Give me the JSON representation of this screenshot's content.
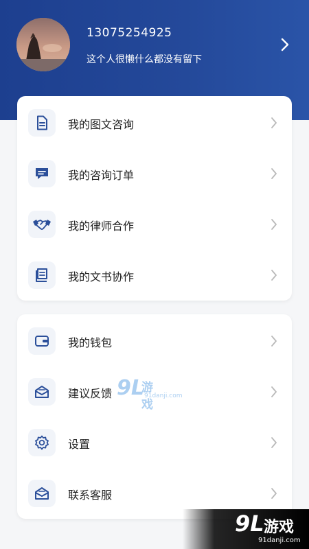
{
  "profile": {
    "phone": "13075254925",
    "signature": "这个人很懒什么都没有留下"
  },
  "menu_group_1": [
    {
      "label": "我的图文咨询",
      "icon": "document-icon"
    },
    {
      "label": "我的咨询订单",
      "icon": "chat-icon"
    },
    {
      "label": "我的律师合作",
      "icon": "handshake-icon"
    },
    {
      "label": "我的文书协作",
      "icon": "book-icon"
    }
  ],
  "menu_group_2": [
    {
      "label": "我的钱包",
      "icon": "wallet-icon"
    },
    {
      "label": "建议反馈",
      "icon": "feedback-icon"
    },
    {
      "label": "设置",
      "icon": "gear-icon"
    },
    {
      "label": "联系客服",
      "icon": "mail-icon"
    }
  ],
  "watermark": {
    "logo": "9L",
    "name": "游戏",
    "site": "91danji.com"
  },
  "colors": {
    "header": "#24499a",
    "icon": "#2b4f9a"
  }
}
